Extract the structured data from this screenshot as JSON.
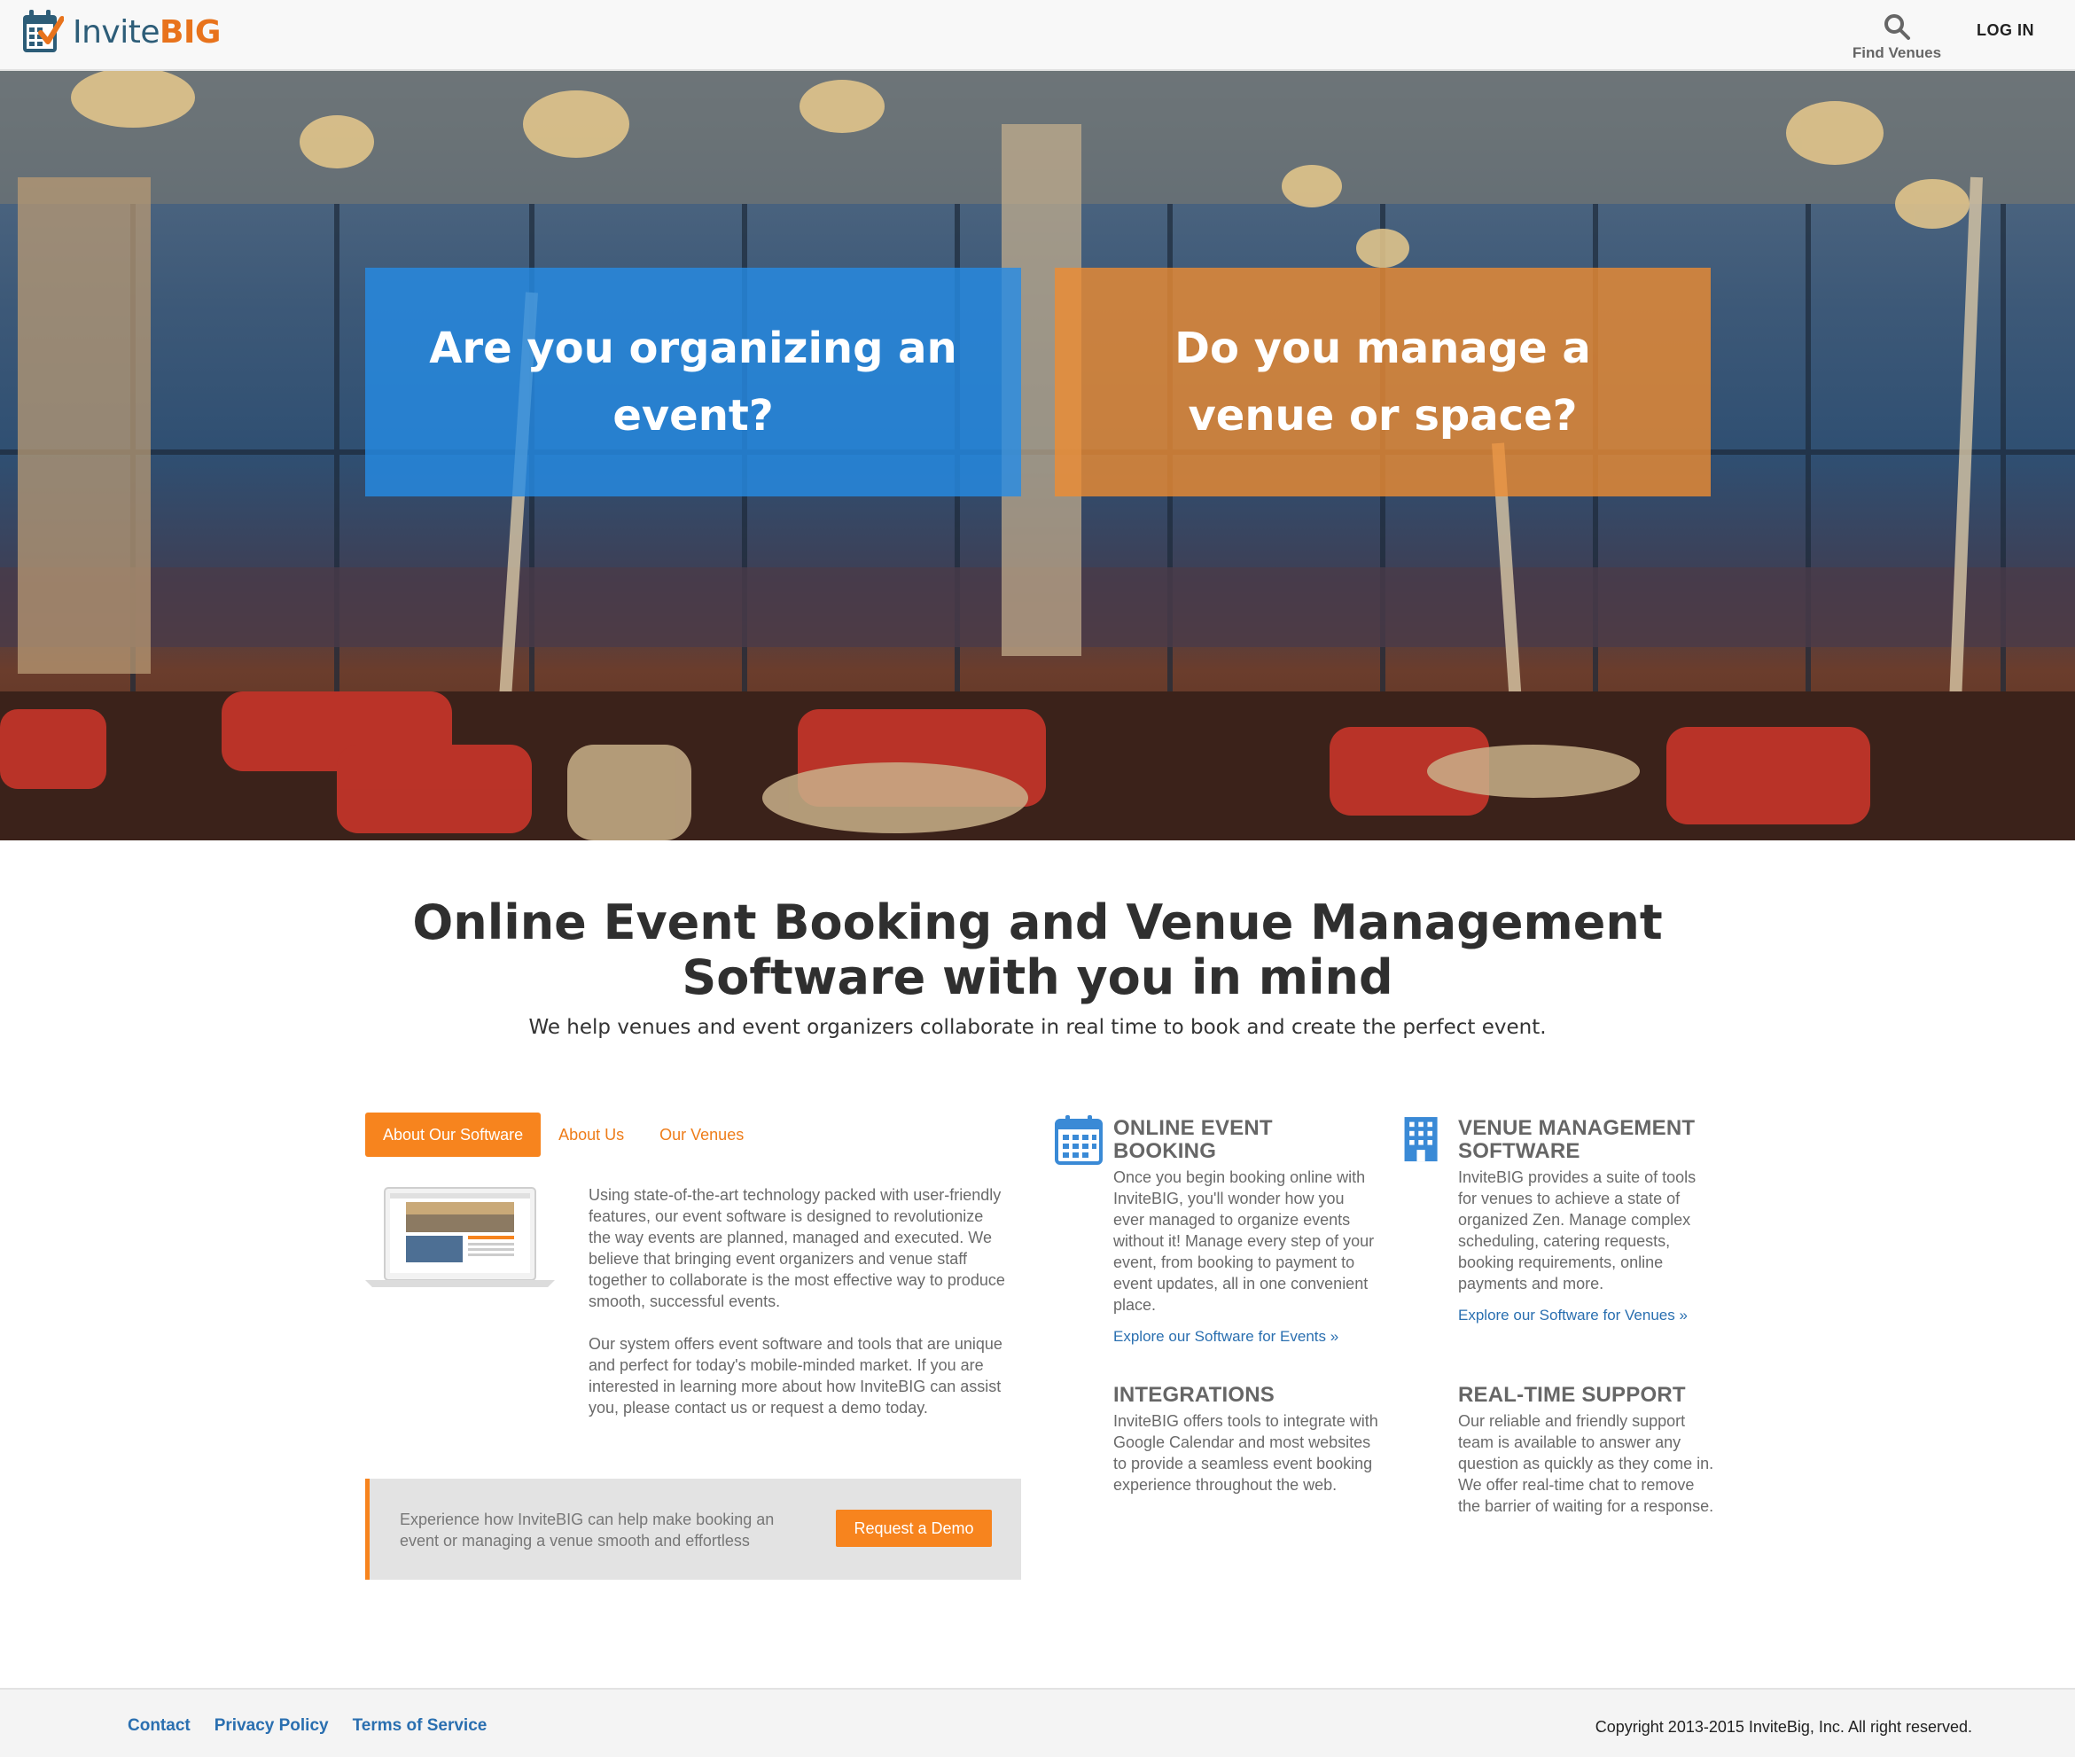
{
  "header": {
    "logo_text_main": "Invite",
    "logo_text_accent": "BIG",
    "find_venues_label": "Find Venues",
    "login_label": "LOG IN"
  },
  "hero": {
    "organizer_card": "Are you organizing an event?",
    "venue_card": "Do you manage a venue or space?"
  },
  "intro": {
    "title": "Online Event Booking and Venue Management Software with you in mind",
    "subtitle": "We help venues and event organizers collaborate in real time to book and create the perfect event."
  },
  "tabs": [
    {
      "label": "About Our Software",
      "active": true
    },
    {
      "label": "About Us",
      "active": false
    },
    {
      "label": "Our Venues",
      "active": false
    }
  ],
  "about": {
    "paragraph1": "Using state-of-the-art technology packed with user-friendly features, our event software is designed to revolutionize the way events are planned, managed and executed. We believe that bringing event organizers and venue staff together to collaborate is the most effective way to produce smooth, successful events.",
    "paragraph2": "Our system offers event software and tools that are unique and perfect for today's mobile-minded market. If you are interested in learning more about how InviteBIG can assist you, please contact us or request a demo today."
  },
  "demo": {
    "text": "Experience how InviteBIG can help make booking an event or managing a venue smooth and effortless",
    "button_label": "Request a Demo"
  },
  "features": {
    "event_booking": {
      "title": "ONLINE EVENT BOOKING",
      "body": "Once you begin booking online with InviteBIG, you'll wonder how you ever managed to organize events without it! Manage every step of your event, from booking to payment to event updates, all in one convenient place.",
      "link": "Explore our Software for Events »",
      "icon": "calendar-icon"
    },
    "venue_management": {
      "title": "VENUE MANAGEMENT SOFTWARE",
      "body": "InviteBIG provides a suite of tools for venues to achieve a state of organized Zen. Manage complex scheduling, catering requests, booking requirements, online payments and more.",
      "link": "Explore our Software for Venues »",
      "icon": "building-icon"
    },
    "integrations": {
      "title": "INTEGRATIONS",
      "body": "InviteBIG offers tools to integrate with Google Calendar and most websites to provide a seamless event booking experience throughout the web."
    },
    "support": {
      "title": "REAL-TIME SUPPORT",
      "body": "Our reliable and friendly support team is available to answer any question as quickly as they come in. We offer real-time chat to remove the barrier of waiting for a response."
    }
  },
  "footer": {
    "links": [
      "Contact",
      "Privacy Policy",
      "Terms of Service"
    ],
    "copyright": "Copyright 2013-2015 InviteBig, Inc. All right reserved."
  },
  "colors": {
    "accent_orange": "#f7841e",
    "brand_blue": "#2d5d78",
    "link_blue": "#2a6fb0",
    "card_blue": "#268ce6"
  }
}
